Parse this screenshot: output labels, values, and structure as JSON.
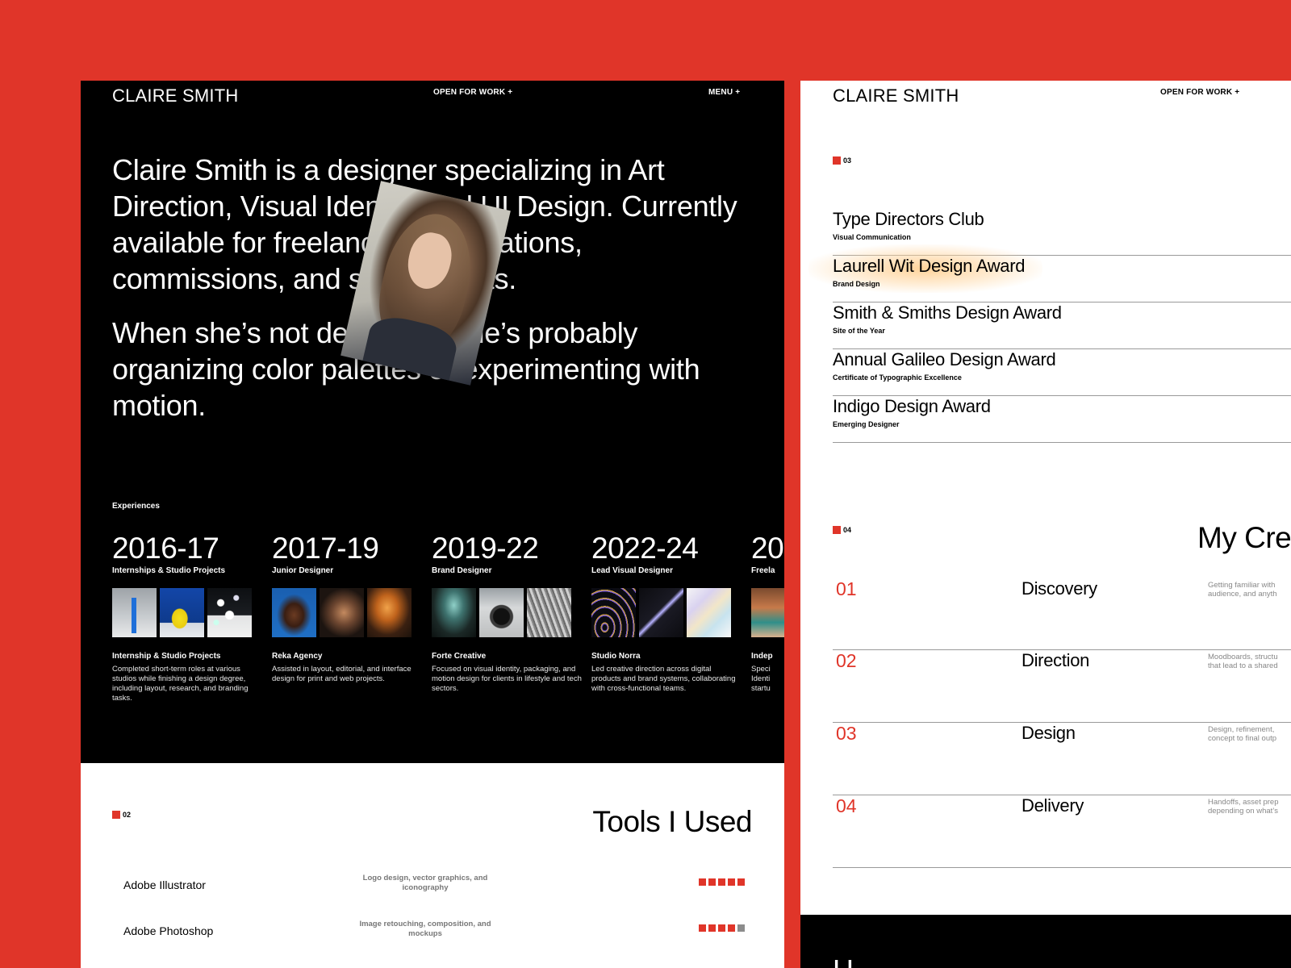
{
  "left": {
    "brand": "CLAIRE SMITH",
    "open_for_work": "OPEN FOR WORK +",
    "menu": "MENU +",
    "intro_p1": "Claire Smith is a designer specializing in Art Direction, Visual Identity and UI Design. Currently available for freelance collaborations, commissions, and side projects.",
    "intro_p2": "When she’s not designing, she’s probably organizing color palettes or experimenting with motion.",
    "experiences_title": "Experiences",
    "experiences": [
      {
        "years": "2016-17",
        "role": "Internships & Studio Projects",
        "company": "Internship & Studio Projects",
        "desc": "Completed short-term roles at various studios while finishing a design degree, including layout, research, and branding tasks."
      },
      {
        "years": "2017-19",
        "role": "Junior Designer",
        "company": "Reka Agency",
        "desc": "Assisted in layout, editorial, and interface design for print and web projects."
      },
      {
        "years": "2019-22",
        "role": "Brand Designer",
        "company": "Forte Creative",
        "desc": "Focused on visual identity, packaging, and motion design for clients in lifestyle and tech sectors."
      },
      {
        "years": "2022-24",
        "role": "Lead Visual Designer",
        "company": "Studio Norra",
        "desc": "Led creative direction across digital products and brand systems, collaborating with cross-functional teams."
      },
      {
        "years": "20",
        "role": "Freela",
        "company": "Indep",
        "desc": "Speci Identi startu"
      }
    ],
    "tools_marker": "02",
    "tools_heading": "Tools I Used",
    "tools": [
      {
        "name": "Adobe Illustrator",
        "desc": "Logo design, vector graphics, and iconography",
        "rating": 5
      },
      {
        "name": "Adobe Photoshop",
        "desc": "Image retouching, composition, and mockups",
        "rating": 4
      }
    ]
  },
  "right": {
    "brand": "CLAIRE SMITH",
    "open_for_work": "OPEN FOR WORK +",
    "awards_marker": "03",
    "awards": [
      {
        "name": "Type Directors Club",
        "category": "Visual Communication",
        "highlighted": false
      },
      {
        "name": "Laurell Wit Design Award",
        "category": "Brand Design",
        "highlighted": true
      },
      {
        "name": "Smith & Smiths Design Award",
        "category": "Site of the Year",
        "highlighted": false
      },
      {
        "name": "Annual Galileo Design Award",
        "category": "Certificate of Typographic Excellence",
        "highlighted": false
      },
      {
        "name": "Indigo Design Award",
        "category": "Emerging Designer",
        "highlighted": false
      }
    ],
    "process_marker": "04",
    "process_heading": "My Cre",
    "steps": [
      {
        "num": "01",
        "name": "Discovery",
        "desc1": "Getting familiar with",
        "desc2": "audience, and anyth"
      },
      {
        "num": "02",
        "name": "Direction",
        "desc1": "Moodboards, structu",
        "desc2": "that lead to a shared"
      },
      {
        "num": "03",
        "name": "Design",
        "desc1": "Design, refinement,",
        "desc2": "concept to final outp"
      },
      {
        "num": "04",
        "name": "Delivery",
        "desc1": "Handoffs, asset prep",
        "desc2": "depending on what’s"
      }
    ],
    "footer_text": "H"
  },
  "colors": {
    "accent": "#e03529",
    "dark_bg": "#000000",
    "light_bg": "#ffffff",
    "rating_off": "#8c8c8c",
    "highlight_glow": "#ffd59a"
  }
}
